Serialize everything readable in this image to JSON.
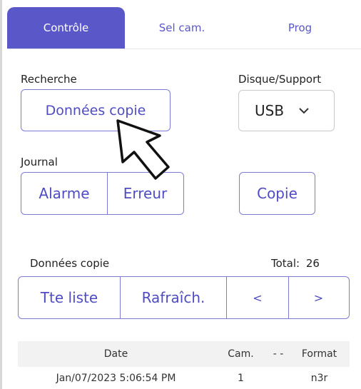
{
  "tabs": [
    {
      "label": "Contrôle",
      "active": true
    },
    {
      "label": "Sel cam."
    },
    {
      "label": "Prog"
    }
  ],
  "search": {
    "label": "Recherche",
    "button": "Données copie"
  },
  "media": {
    "label": "Disque/Support",
    "selected": "USB"
  },
  "journal": {
    "label": "Journal",
    "alarm": "Alarme",
    "error": "Erreur",
    "copy": "Copie"
  },
  "copy_data": {
    "label": "Données copie",
    "total_label": "Total:",
    "total_value": "26",
    "all_list": "Tte liste",
    "refresh": "Rafraîch.",
    "prev": "<",
    "next": ">"
  },
  "table": {
    "headers": {
      "date": "Date",
      "cam": "Cam.",
      "sep": "- -",
      "format": "Format"
    },
    "rows": [
      {
        "date": "Jan/07/2023 5:06:54 PM",
        "cam": "1",
        "format": "n3r"
      }
    ]
  },
  "colors": {
    "accent": "#5a57c8",
    "border": "#7e7bd6"
  },
  "icons": {
    "cursor": "arrow-cursor-icon",
    "dropdown": "chevron-down-icon"
  }
}
